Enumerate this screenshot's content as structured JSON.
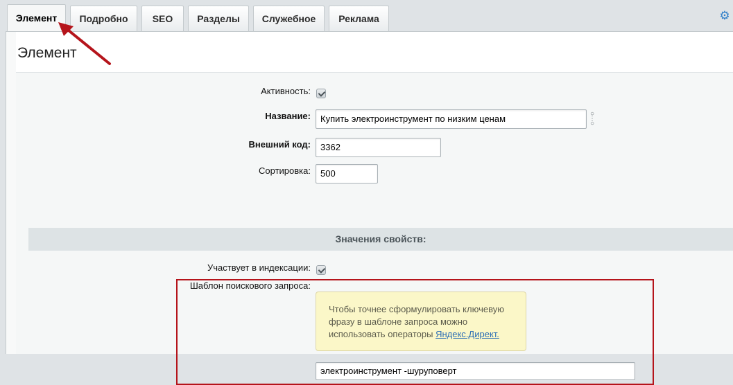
{
  "tabs": [
    {
      "label": "Элемент"
    },
    {
      "label": "Подробно"
    },
    {
      "label": "SEO"
    },
    {
      "label": "Разделы"
    },
    {
      "label": "Служебное"
    },
    {
      "label": "Реклама"
    }
  ],
  "panel": {
    "title": "Элемент"
  },
  "fields": {
    "active": {
      "label": "Активность:",
      "checked": true
    },
    "name": {
      "label": "Название:",
      "value": "Купить электроинструмент по низким ценам"
    },
    "external_code": {
      "label": "Внешний код:",
      "value": "3362"
    },
    "sort": {
      "label": "Сортировка:",
      "value": "500"
    }
  },
  "properties": {
    "section_title": "Значения свойств:",
    "indexing": {
      "label": "Участвует в индексации:",
      "checked": true
    },
    "search_template": {
      "label": "Шаблон поискового запроса:",
      "hint_text": "Чтобы точнее сформулировать ключевую фразу в шаблоне запроса можно использовать операторы",
      "hint_link": "Яндекс.Директ.",
      "value": "электроинструмент -шуруповерт"
    }
  },
  "colors": {
    "highlight": "#b5141b",
    "accent": "#2f7fc9"
  },
  "icons": {
    "settings": "gear-icon",
    "translit": "chain-link-icon",
    "annotation": "red-arrow-icon"
  }
}
